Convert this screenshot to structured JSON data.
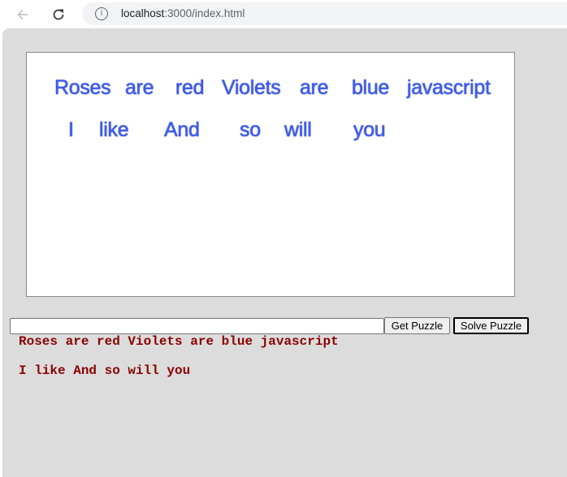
{
  "browser": {
    "url_host": "localhost",
    "url_path": ":3000/index.html"
  },
  "puzzle": {
    "line1": [
      "Roses",
      "are",
      "red",
      "Violets",
      "are",
      "blue",
      "javascript"
    ],
    "line2": [
      "I",
      "like",
      "And",
      "so",
      "will",
      "you"
    ]
  },
  "controls": {
    "input_value": "",
    "get_label": "Get Puzzle",
    "solve_label": "Solve Puzzle"
  },
  "output": {
    "line1": "Roses are red Violets are blue javascript",
    "line2": "I like And so will you"
  },
  "colors": {
    "word": "#3c5cf0",
    "output": "#8b0000",
    "background": "#dcdcdc"
  }
}
